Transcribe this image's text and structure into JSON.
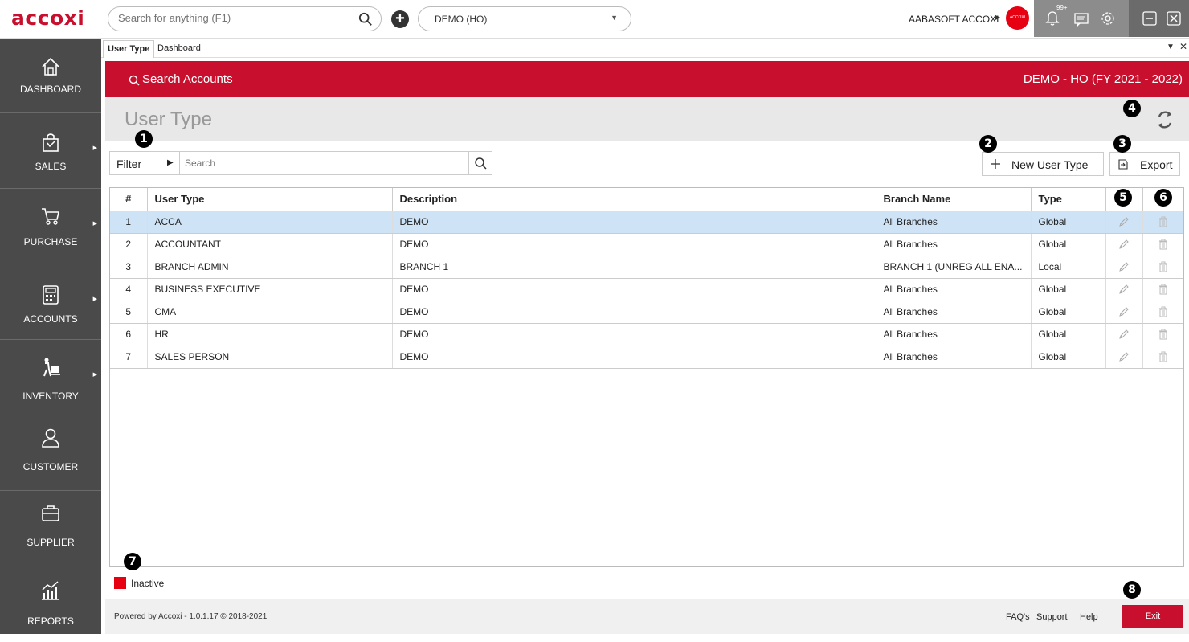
{
  "app": {
    "logo": "accoxi",
    "search_placeholder": "Search for anything (F1)",
    "company": "DEMO (HO)",
    "user_name": "AABASOFT ACCOXI",
    "avatar_text": "ACCOXI",
    "notifications_count": "99+"
  },
  "sidebar": {
    "items": [
      {
        "label": "DASHBOARD",
        "icon": "home-icon",
        "has_submenu": false
      },
      {
        "label": "SALES",
        "icon": "shopping-bag-icon",
        "has_submenu": true
      },
      {
        "label": "PURCHASE",
        "icon": "cart-icon",
        "has_submenu": true
      },
      {
        "label": "ACCOUNTS",
        "icon": "calculator-icon",
        "has_submenu": true
      },
      {
        "label": "INVENTORY",
        "icon": "inventory-icon",
        "has_submenu": true
      },
      {
        "label": "CUSTOMER",
        "icon": "customer-icon",
        "has_submenu": false
      },
      {
        "label": "SUPPLIER",
        "icon": "briefcase-icon",
        "has_submenu": false
      },
      {
        "label": "REPORTS",
        "icon": "reports-icon",
        "has_submenu": false
      }
    ]
  },
  "tabs": [
    {
      "label": "User Type",
      "active": true
    },
    {
      "label": "Dashboard",
      "active": false
    }
  ],
  "header": {
    "search_accounts": "Search Accounts",
    "company_fy": "DEMO - HO (FY 2021 - 2022)"
  },
  "page": {
    "title": "User Type"
  },
  "toolbar": {
    "filter_label": "Filter",
    "search_placeholder": "Search",
    "new_button": "New User Type",
    "export_button": "Export"
  },
  "table": {
    "columns": [
      "#",
      "User Type",
      "Description",
      "Branch Name",
      "Type"
    ],
    "rows": [
      {
        "num": "1",
        "user_type": "ACCA",
        "description": "DEMO",
        "branch": "All Branches",
        "type": "Global",
        "selected": true
      },
      {
        "num": "2",
        "user_type": "ACCOUNTANT",
        "description": "DEMO",
        "branch": "All Branches",
        "type": "Global",
        "selected": false
      },
      {
        "num": "3",
        "user_type": "BRANCH ADMIN",
        "description": "BRANCH 1",
        "branch": "BRANCH 1 (UNREG ALL ENA...",
        "type": "Local",
        "selected": false
      },
      {
        "num": "4",
        "user_type": "BUSINESS EXECUTIVE",
        "description": "DEMO",
        "branch": "All Branches",
        "type": "Global",
        "selected": false
      },
      {
        "num": "5",
        "user_type": "CMA",
        "description": "DEMO",
        "branch": "All Branches",
        "type": "Global",
        "selected": false
      },
      {
        "num": "6",
        "user_type": "HR",
        "description": "DEMO",
        "branch": "All Branches",
        "type": "Global",
        "selected": false
      },
      {
        "num": "7",
        "user_type": "SALES PERSON",
        "description": "DEMO",
        "branch": "All Branches",
        "type": "Global",
        "selected": false
      }
    ]
  },
  "legend": {
    "inactive_label": "Inactive",
    "inactive_color": "#e60012"
  },
  "badges": [
    "1",
    "2",
    "3",
    "4",
    "5",
    "6",
    "7",
    "8"
  ],
  "footer": {
    "powered_by": "Powered by Accoxi - 1.0.1.17 © 2018-2021",
    "links": [
      "FAQ's",
      "Support",
      "Help"
    ],
    "exit_label": "Exit"
  },
  "colors": {
    "brand_red": "#c8102e",
    "sidebar_bg": "#4a4a4a",
    "selected_row": "#cfe3f7"
  }
}
